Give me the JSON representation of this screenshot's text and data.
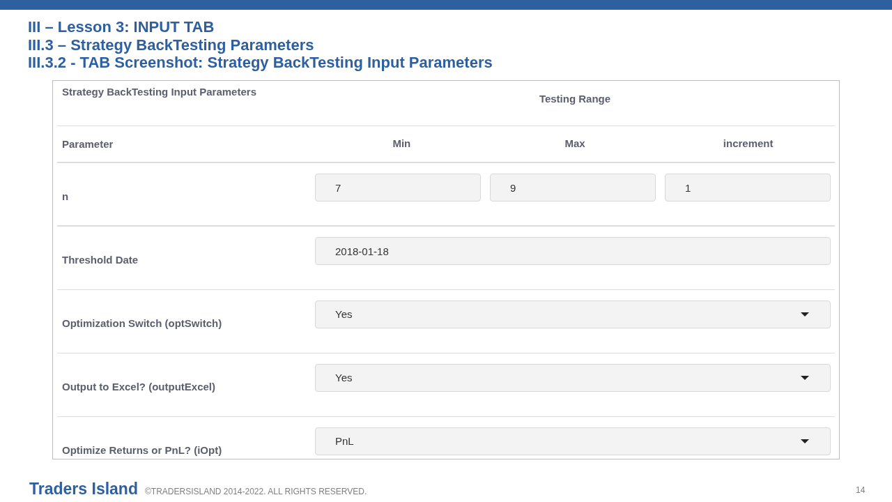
{
  "slide": {
    "titles": [
      "III – Lesson 3: INPUT TAB",
      "III.3 – Strategy BackTesting Parameters",
      "III.3.2 - TAB Screenshot: Strategy BackTesting Input Parameters"
    ]
  },
  "table": {
    "title": "Strategy BackTesting Input Parameters",
    "range_heading": "Testing Range",
    "columns": [
      "Parameter",
      "Min",
      "Max",
      "increment"
    ],
    "rows": [
      {
        "kind": "range",
        "label": "n",
        "values": [
          "7",
          "9",
          "1"
        ]
      },
      {
        "kind": "text",
        "label": "Threshold Date",
        "value": "2018-01-18"
      },
      {
        "kind": "select",
        "label": "Optimization Switch (optSwitch)",
        "value": "Yes"
      },
      {
        "kind": "select",
        "label": "Output to Excel? (outputExcel)",
        "value": "Yes"
      },
      {
        "kind": "select",
        "label": "Optimize Returns or PnL? (iOpt)",
        "value": "PnL"
      }
    ]
  },
  "footer": {
    "brand": "Traders Island",
    "copyright": "©TRADERSISLAND 2014-2022. ALL RIGHTS RESERVED.",
    "page": "14"
  }
}
